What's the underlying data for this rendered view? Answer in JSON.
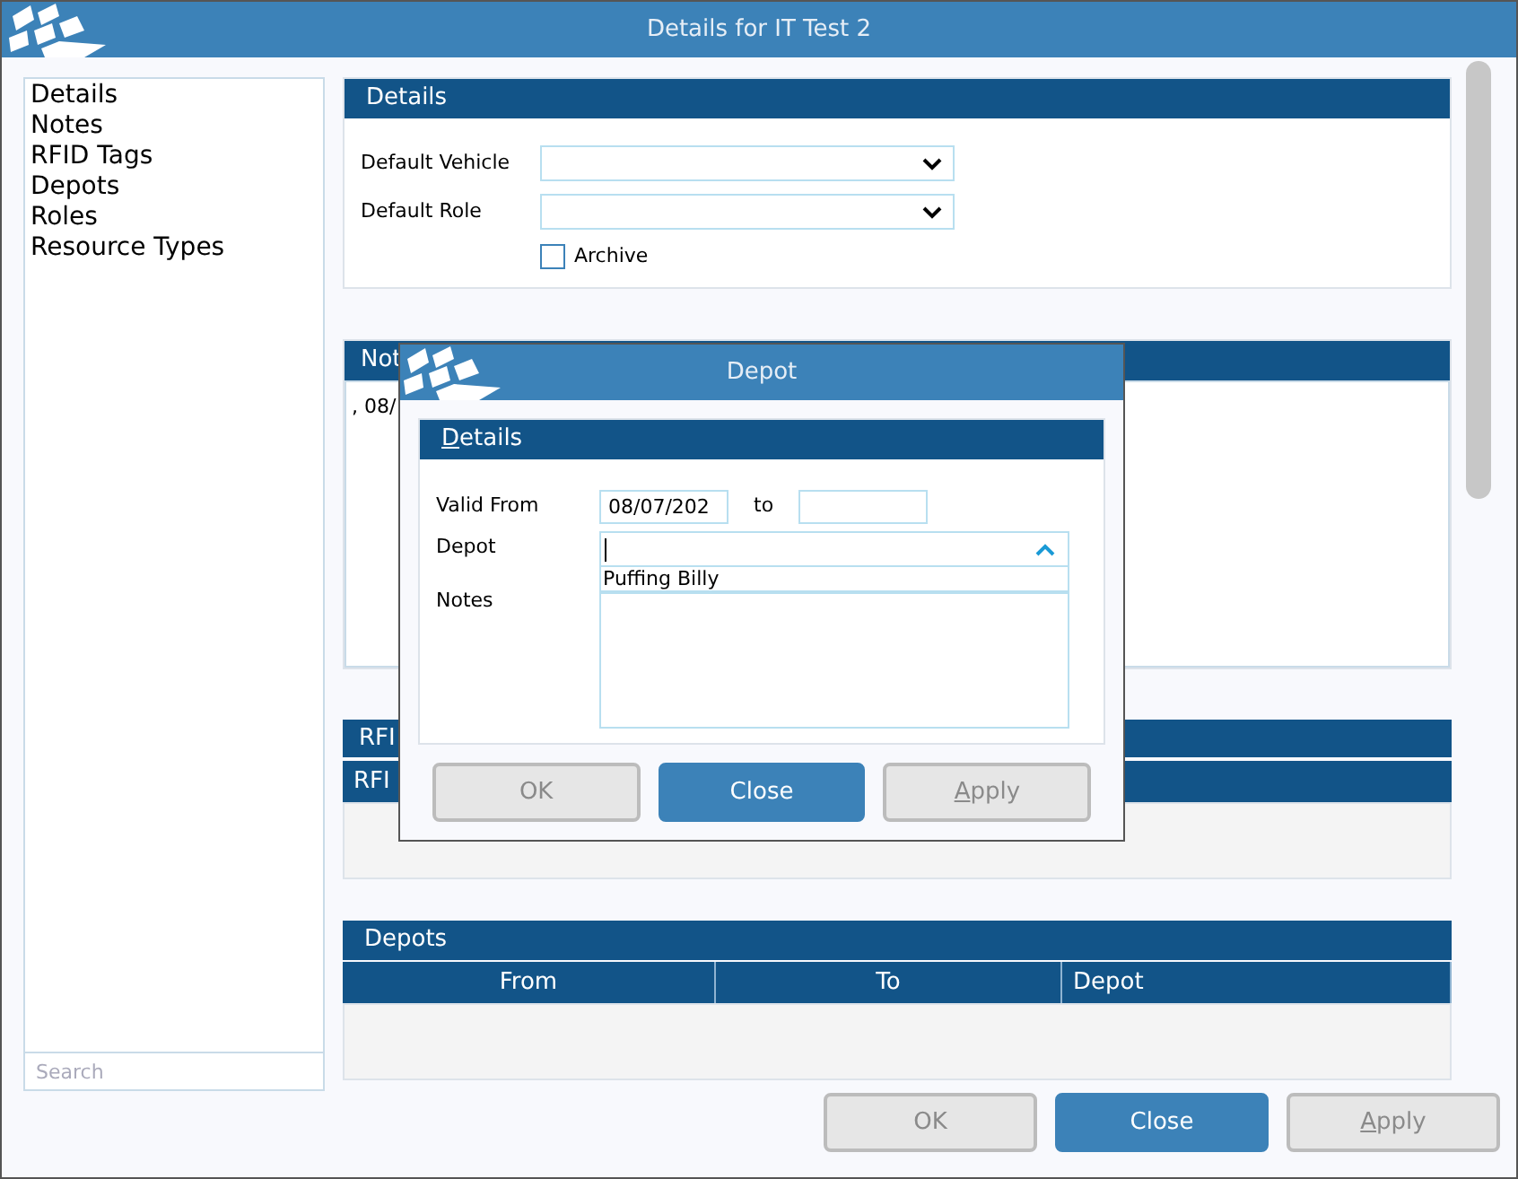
{
  "window": {
    "title": "Details for IT Test 2"
  },
  "sidebar": {
    "items": [
      {
        "label": "Details"
      },
      {
        "label": "Notes"
      },
      {
        "label": "RFID Tags"
      },
      {
        "label": "Depots"
      },
      {
        "label": "Roles"
      },
      {
        "label": "Resource Types"
      }
    ],
    "search": {
      "placeholder": "Search"
    }
  },
  "details": {
    "title": "Details",
    "fields": [
      {
        "label": "Default Vehicle",
        "kind": "select"
      },
      {
        "label": "Default Role",
        "kind": "select"
      }
    ],
    "archive": {
      "label": "Archive",
      "checked": false
    }
  },
  "notes": {
    "title": "Not",
    "text": ", 08/"
  },
  "rfid": {
    "title": "RFI",
    "columns": [
      "RFI"
    ]
  },
  "depots": {
    "title": "Depots",
    "columns": [
      "From",
      "To",
      "Depot"
    ]
  },
  "buttons": [
    {
      "label": "OK",
      "kind": "secondary",
      "disabled": true,
      "mnemonic": false
    },
    {
      "label": "Close",
      "kind": "primary",
      "disabled": false,
      "mnemonic": false
    },
    {
      "label": "Apply",
      "kind": "secondary",
      "disabled": true,
      "mnemonic": true
    }
  ],
  "dialog": {
    "title": "Depot",
    "section": {
      "title": "Details",
      "mnemonic": true
    },
    "valid_from": {
      "label": "Valid From",
      "value": "08/07/202",
      "to_label": "to"
    },
    "depot": {
      "label": "Depot",
      "expanded": true,
      "options": [
        "Puffing Billy"
      ]
    },
    "notes": {
      "label": "Notes"
    },
    "buttons": [
      {
        "label": "OK",
        "kind": "secondary",
        "disabled": true,
        "mnemonic": false
      },
      {
        "label": "Close",
        "kind": "primary",
        "disabled": false,
        "mnemonic": false
      },
      {
        "label": "Apply",
        "kind": "secondary",
        "disabled": true,
        "mnemonic": true
      }
    ]
  }
}
